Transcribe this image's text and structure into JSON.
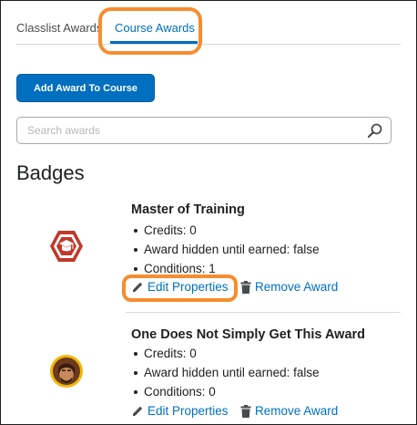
{
  "tabs": [
    {
      "label": "Classlist Awards",
      "active": false
    },
    {
      "label": "Course Awards",
      "active": true
    }
  ],
  "toolbar": {
    "add_label": "Add Award To Course"
  },
  "search": {
    "placeholder": "Search awards",
    "value": "",
    "icon": "search-icon"
  },
  "section": {
    "title": "Badges"
  },
  "awards": [
    {
      "name": "Master of Training",
      "icon": "graduation-cap-hexagon-badge",
      "details": [
        "Credits: 0",
        "Award hidden until earned: false",
        "Conditions: 1"
      ],
      "edit_label": "Edit Properties",
      "remove_label": "Remove Award"
    },
    {
      "name": "One Does Not Simply Get This Award",
      "icon": "portrait-circle-badge",
      "details": [
        "Credits: 0",
        "Award hidden until earned: false",
        "Conditions: 0"
      ],
      "edit_label": "Edit Properties",
      "remove_label": "Remove Award"
    }
  ],
  "colors": {
    "accent": "#006fbf",
    "highlight": "#f68d2e",
    "badge_red": "#c0392b"
  }
}
